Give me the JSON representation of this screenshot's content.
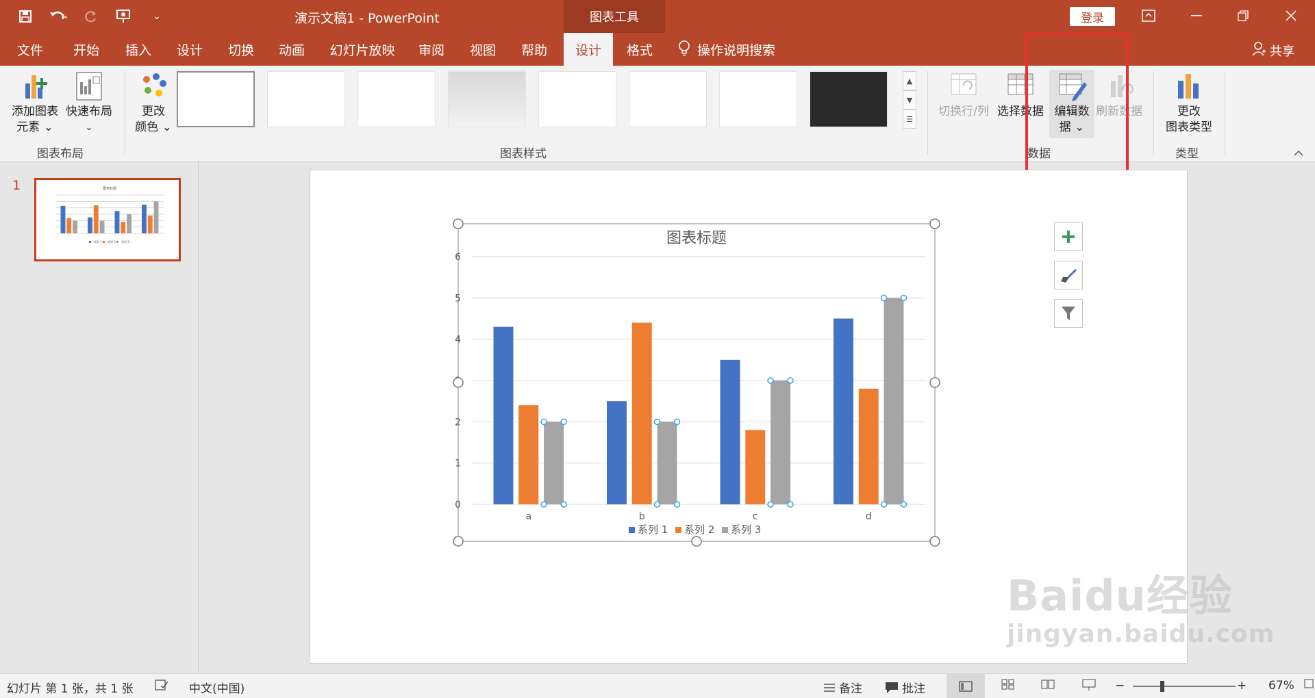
{
  "titlebar": {
    "doc_title": "演示文稿1  -  PowerPoint",
    "context_tools": "图表工具",
    "login": "登录",
    "qat_customize": "⌄"
  },
  "tabs": [
    {
      "label": "文件"
    },
    {
      "label": "开始"
    },
    {
      "label": "插入"
    },
    {
      "label": "设计"
    },
    {
      "label": "切换"
    },
    {
      "label": "动画"
    },
    {
      "label": "幻灯片放映"
    },
    {
      "label": "审阅"
    },
    {
      "label": "视图"
    },
    {
      "label": "帮助"
    },
    {
      "label": "设计"
    },
    {
      "label": "格式"
    }
  ],
  "search": {
    "label": "操作说明搜索"
  },
  "share": {
    "label": "共享"
  },
  "ribbon": {
    "add_element": {
      "line1": "添加图表",
      "line2": "元素 ⌄"
    },
    "quick_layout": {
      "line1": "快速布局",
      "line2": "⌄"
    },
    "change_colors": {
      "line1": "更改",
      "line2": "颜色 ⌄"
    },
    "switch_row_col": {
      "label": "切换行/列"
    },
    "select_data": {
      "label": "选择数据"
    },
    "edit_data": {
      "line1": "编辑数",
      "line2": "据 ⌄"
    },
    "refresh_data": {
      "label": "刷新数据"
    },
    "change_type": {
      "line1": "更改",
      "line2": "图表类型"
    },
    "groups": {
      "chart_layout": "图表布局",
      "chart_styles": "图表样式",
      "data": "数据",
      "type": "类型"
    }
  },
  "thumbnail": {
    "slide_number": "1"
  },
  "chart_data": {
    "type": "bar",
    "title": "图表标题",
    "categories": [
      "a",
      "b",
      "c",
      "d"
    ],
    "series": [
      {
        "name": "系列 1",
        "values": [
          4.3,
          2.5,
          3.5,
          4.5
        ],
        "color": "#4472c4"
      },
      {
        "name": "系列 2",
        "values": [
          2.4,
          4.4,
          1.8,
          2.8
        ],
        "color": "#ed7d31"
      },
      {
        "name": "系列 3",
        "values": [
          2,
          2,
          3,
          5
        ],
        "color": "#a5a5a5"
      }
    ],
    "ylim": [
      0,
      6
    ],
    "yticks": [
      "0",
      "1",
      "2",
      "3",
      "4",
      "5",
      "6"
    ],
    "grid": true,
    "legend_position": "bottom"
  },
  "statusbar": {
    "slide_info": "幻灯片 第 1 张，共 1 张",
    "language": "中文(中国)",
    "notes": "备注",
    "comments": "批注",
    "zoom_minus": "−",
    "zoom_plus": "+",
    "zoom": "67%"
  },
  "watermark": {
    "brand": "Baidu经验",
    "url": "jingyan.baidu.com"
  }
}
